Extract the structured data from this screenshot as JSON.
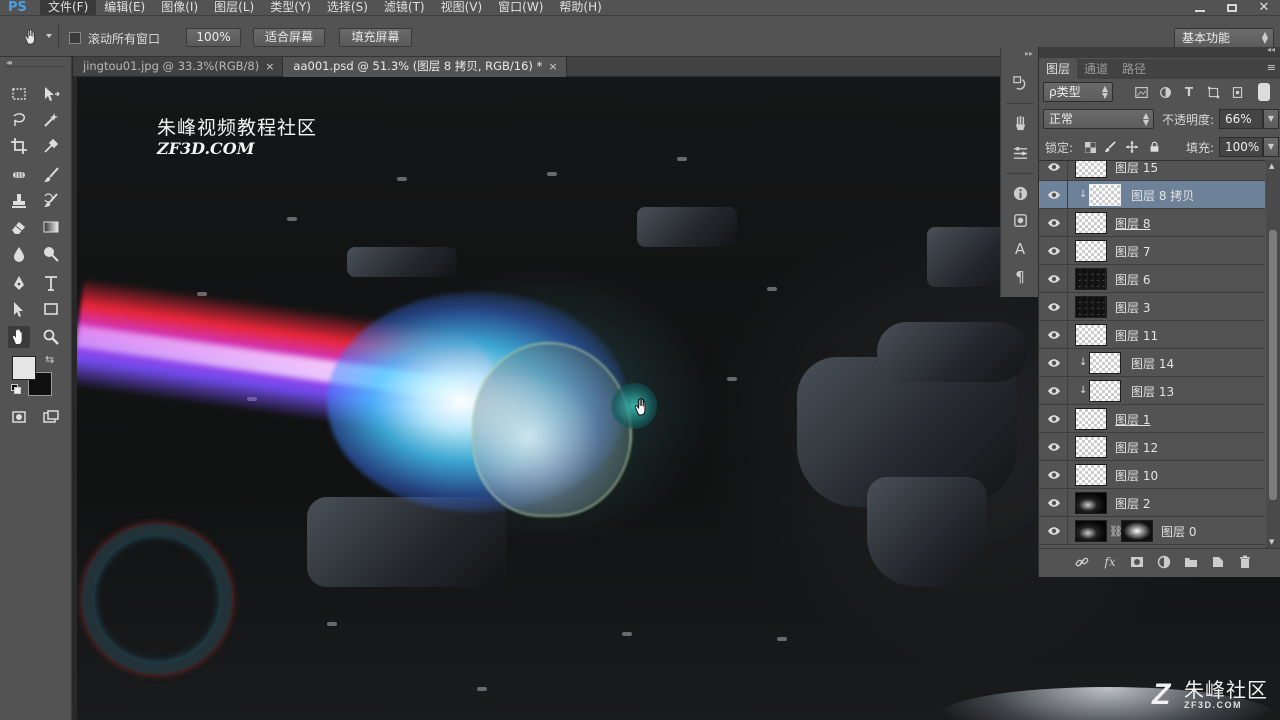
{
  "app": {
    "logo": "PS"
  },
  "menu": {
    "items": [
      "文件(F)",
      "编辑(E)",
      "图像(I)",
      "图层(L)",
      "类型(Y)",
      "选择(S)",
      "滤镜(T)",
      "视图(V)",
      "窗口(W)",
      "帮助(H)"
    ],
    "active_index": 0
  },
  "options": {
    "scroll_all_label": "滚动所有窗口",
    "scroll_all_checked": false,
    "zoom_100_label": "100%",
    "fit_screen_label": "适合屏幕",
    "fill_screen_label": "填充屏幕",
    "workspace_label": "基本功能"
  },
  "tabs": [
    {
      "title": "jingtou01.jpg @ 33.3%(RGB/8)",
      "close": "×",
      "active": false
    },
    {
      "title": "aa001.psd @ 51.3% (图层 8 拷贝, RGB/16) *",
      "close": "×",
      "active": true
    }
  ],
  "canvas": {
    "watermark_title": "朱峰视频教程社区",
    "watermark_url": "ZF3D.COM",
    "corner_logo_mark": "Z",
    "corner_logo_text": "朱峰社区",
    "corner_logo_url": "ZF3D.COM"
  },
  "layers_panel": {
    "tabs": [
      "图层",
      "通道",
      "路径"
    ],
    "active_tab": 0,
    "filter_kind": "ρ类型",
    "blend_mode": "正常",
    "opacity_label": "不透明度:",
    "opacity_value": "66%",
    "lock_label": "锁定:",
    "fill_label": "填充:",
    "fill_value": "100%",
    "layers": [
      {
        "name": "图层 15",
        "thumb": "checker",
        "clipped": false,
        "selected": false,
        "underline": false
      },
      {
        "name": "图层 8 拷贝",
        "thumb": "checker",
        "clipped": true,
        "selected": true,
        "underline": false
      },
      {
        "name": "图层 8",
        "thumb": "checker",
        "clipped": false,
        "selected": false,
        "underline": true
      },
      {
        "name": "图层 7",
        "thumb": "checker",
        "clipped": false,
        "selected": false,
        "underline": false
      },
      {
        "name": "图层 6",
        "thumb": "spots",
        "clipped": false,
        "selected": false,
        "underline": false
      },
      {
        "name": "图层 3",
        "thumb": "spots",
        "clipped": false,
        "selected": false,
        "underline": false
      },
      {
        "name": "图层 11",
        "thumb": "checker",
        "clipped": false,
        "selected": false,
        "underline": false
      },
      {
        "name": "图层 14",
        "thumb": "checker",
        "clipped": true,
        "selected": false,
        "underline": false
      },
      {
        "name": "图层 13",
        "thumb": "checker",
        "clipped": true,
        "selected": false,
        "underline": false
      },
      {
        "name": "图层 1",
        "thumb": "checker",
        "clipped": false,
        "selected": false,
        "underline": true
      },
      {
        "name": "图层 12",
        "thumb": "checker",
        "clipped": false,
        "selected": false,
        "underline": false
      },
      {
        "name": "图层 10",
        "thumb": "checker",
        "clipped": false,
        "selected": false,
        "underline": false
      },
      {
        "name": "图层 2",
        "thumb": "dark",
        "clipped": false,
        "selected": false,
        "underline": false
      },
      {
        "name": "图层 0",
        "thumb": "dark",
        "clipped": false,
        "selected": false,
        "underline": false,
        "has_mask": true
      }
    ],
    "footer_icons": [
      "link-icon",
      "fx-icon",
      "add-mask-icon",
      "adjustment-icon",
      "group-folder-icon",
      "new-layer-icon",
      "trash-icon"
    ],
    "footer_fx_label": "fx"
  },
  "colors": {
    "foreground": "#e6e6e6",
    "background": "#101010",
    "selected_layer": "#6d8298",
    "ui_panel": "#535353"
  }
}
